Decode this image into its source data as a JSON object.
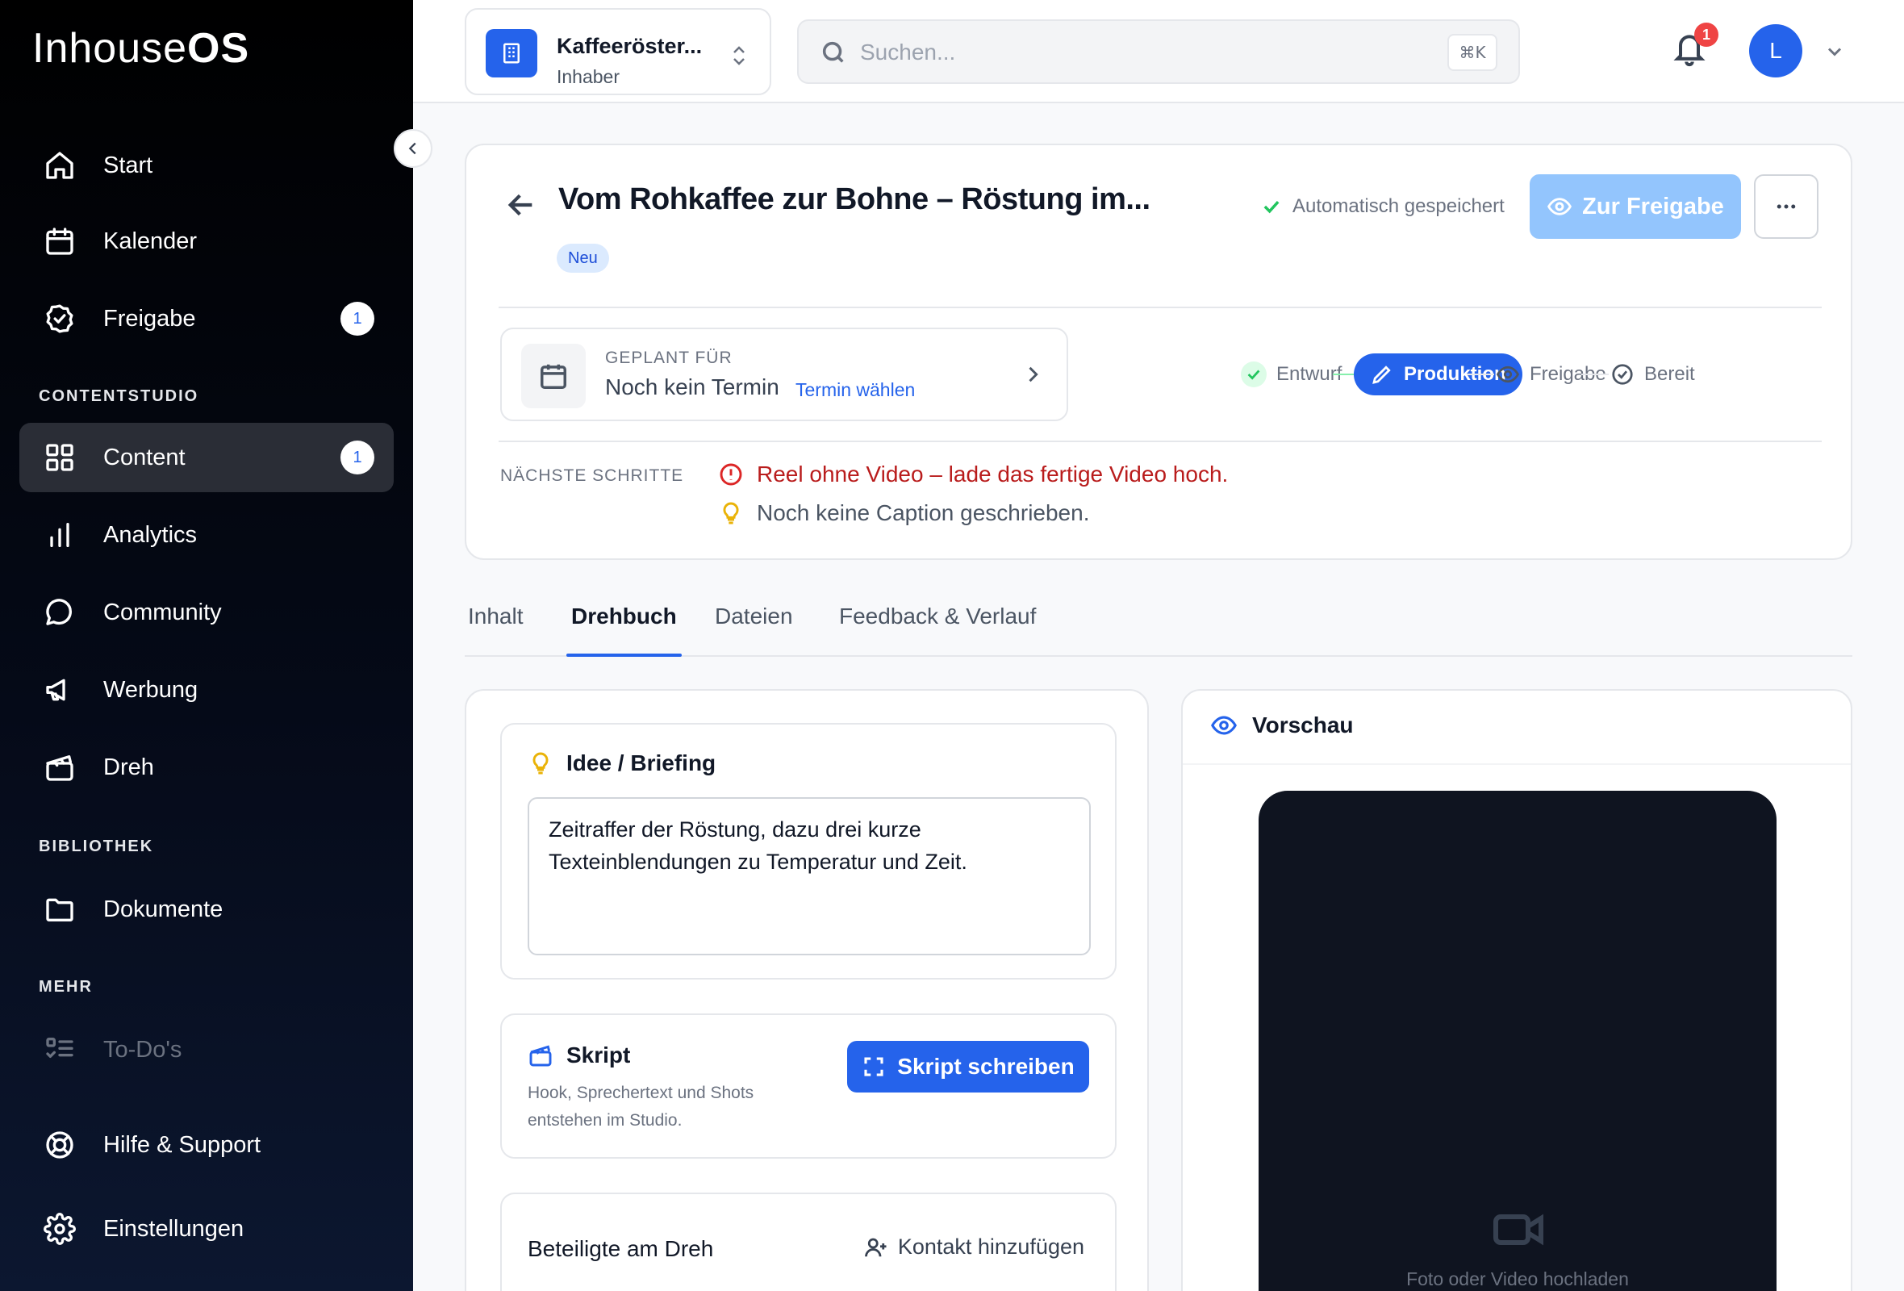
{
  "app": {
    "logo_light": "Inhouse",
    "logo_bold": "OS"
  },
  "sidebar": {
    "items": [
      {
        "label": "Start",
        "icon": "home-icon"
      },
      {
        "label": "Kalender",
        "icon": "calendar-icon"
      },
      {
        "label": "Freigabe",
        "icon": "check-circle-icon",
        "badge": "1"
      },
      {
        "label": "Content",
        "icon": "grid-icon",
        "badge": "1",
        "active": true
      },
      {
        "label": "Analytics",
        "icon": "bar-chart-icon"
      },
      {
        "label": "Community",
        "icon": "chat-bubble-icon"
      },
      {
        "label": "Werbung",
        "icon": "megaphone-icon"
      },
      {
        "label": "Dreh",
        "icon": "clapperboard-icon"
      },
      {
        "label": "Dokumente",
        "icon": "folder-icon"
      },
      {
        "label": "To-Do's",
        "icon": "checklist-icon",
        "disabled": true
      },
      {
        "label": "Hilfe & Support",
        "icon": "lifebuoy-icon"
      },
      {
        "label": "Einstellungen",
        "icon": "gear-icon"
      }
    ],
    "sections": {
      "contentstudio": "CONTENTSTUDIO",
      "bibliothek": "BIBLIOTHEK",
      "mehr": "MEHR"
    }
  },
  "topbar": {
    "workspace_name": "Kaffeeröster...",
    "workspace_role": "Inhaber",
    "search_placeholder": "Suchen...",
    "search_shortcut": "⌘K",
    "notification_count": "1",
    "avatar_initial": "L"
  },
  "header": {
    "title": "Vom Rohkaffee zur Bohne – Röstung im...",
    "status_badge": "Neu",
    "autosave": "Automatisch gespeichert",
    "approve_label": "Zur Freigabe",
    "schedule_label": "GEPLANT FÜR",
    "schedule_value": "Noch kein Termin",
    "schedule_link": "Termin wählen",
    "steps": [
      "Entwurf",
      "Produktion",
      "Freigabe",
      "Bereit"
    ],
    "current_step": "Produktion",
    "next_steps_label": "NÄCHSTE SCHRITTE",
    "next_error": "Reel ohne Video – lade das fertige Video hoch.",
    "next_hint": "Noch keine Caption geschrieben."
  },
  "tabs": [
    "Inhalt",
    "Drehbuch",
    "Dateien",
    "Feedback & Verlauf"
  ],
  "active_tab": "Drehbuch",
  "idea": {
    "title": "Idee / Briefing",
    "text": "Zeitraffer der Röstung, dazu drei kurze Texteinblendungen zu Temperatur und Zeit."
  },
  "script": {
    "title": "Skript",
    "description": "Hook, Sprechertext und Shots entstehen im Studio.",
    "button": "Skript schreiben"
  },
  "participants": {
    "title": "Beteiligte am Dreh",
    "add_button": "Kontakt hinzufügen"
  },
  "preview": {
    "title": "Vorschau",
    "upload_label": "Foto oder Video hochladen"
  },
  "colors": {
    "accent": "#2563eb",
    "error": "#dc2626",
    "success": "#22c55e",
    "sidebar_bg": "#000000"
  }
}
